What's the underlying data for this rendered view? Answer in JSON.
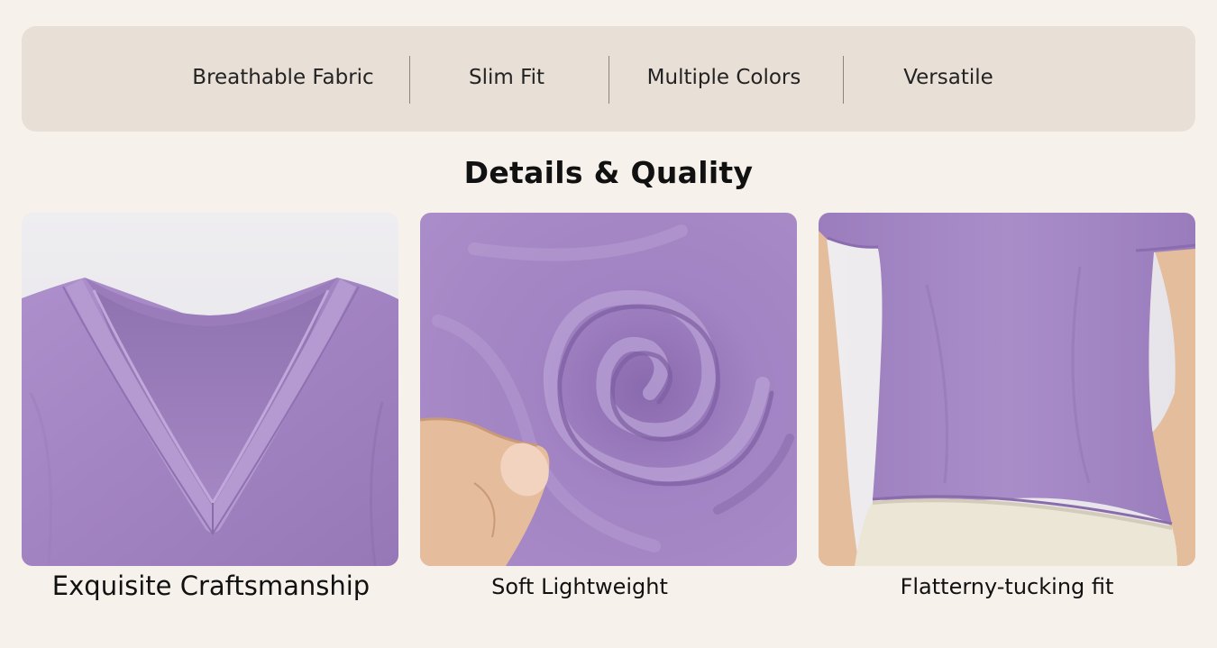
{
  "features": [
    {
      "label": "Breathable Fabric"
    },
    {
      "label": "Slim Fit"
    },
    {
      "label": "Multiple Colors"
    },
    {
      "label": "Versatile"
    }
  ],
  "section_title": "Details & Quality",
  "cards": [
    {
      "caption": "Exquisite Craftsmanship",
      "subject": "v-neck-collar"
    },
    {
      "caption": "Soft Lightweight",
      "subject": "fabric-swirl"
    },
    {
      "caption": "Flatterny-tucking fit",
      "subject": "torso-fit"
    }
  ],
  "colors": {
    "page_background": "#f6f2eb",
    "feature_bar": "#e8dfd6",
    "fabric_purple": "#a88bc7",
    "fabric_purple_dark": "#8d6fb0",
    "skin": "#e9c4a6",
    "cream_pants": "#ece6d7"
  }
}
